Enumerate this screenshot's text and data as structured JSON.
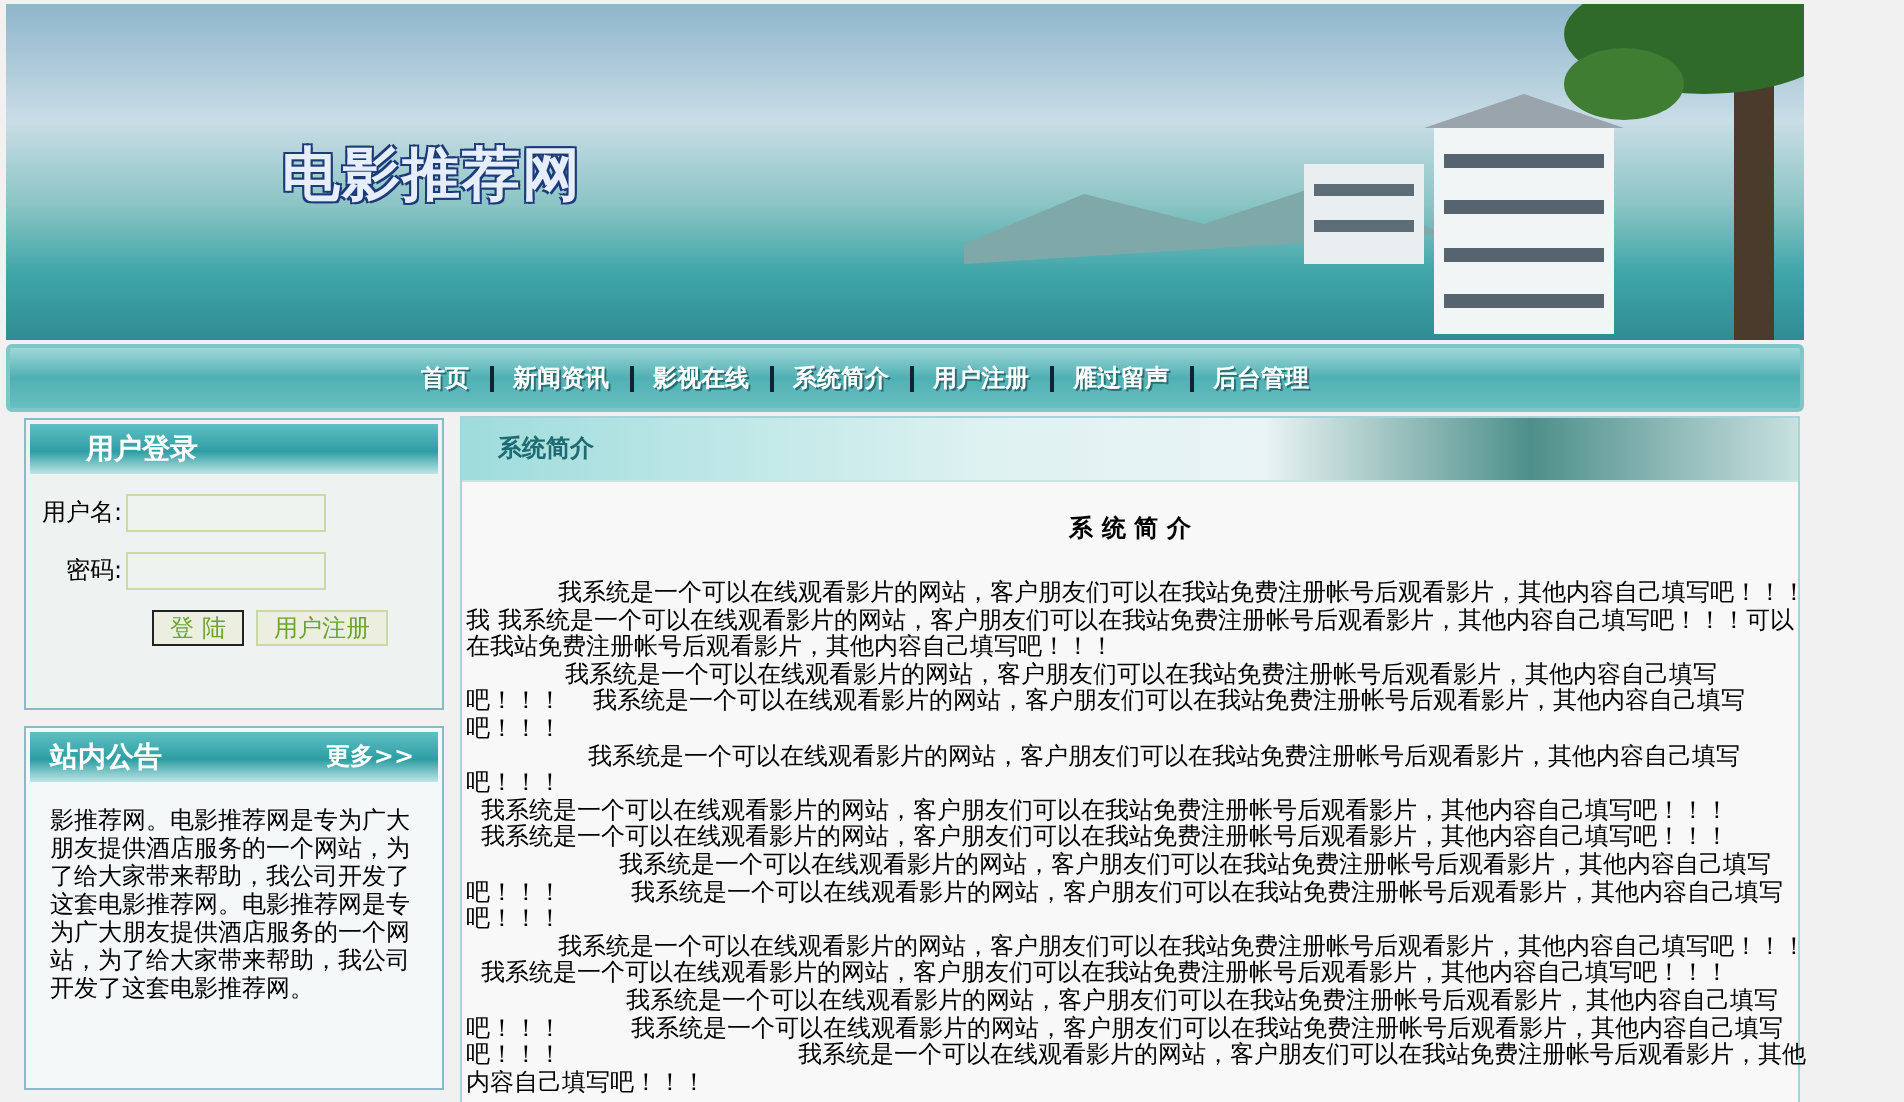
{
  "site_title": "电影推荐网",
  "nav": [
    "首页",
    "新闻资讯",
    "影视在线",
    "系统简介",
    "用户注册",
    "雁过留声",
    "后台管理"
  ],
  "login": {
    "title": "用户登录",
    "fields": [
      {
        "label": "用户名:"
      },
      {
        "label": "密码:"
      }
    ],
    "buttons": [
      {
        "label": "登 陆",
        "kind": "primary"
      },
      {
        "label": "用户注册",
        "kind": "secondary"
      }
    ]
  },
  "notice": {
    "title": "站内公告",
    "more": "更多>>",
    "text": "影推荐网。电影推荐网是专为广大朋友提供酒店服务的一个网站，为了给大家带来帮助，我公司开发了这套电影推荐网。电影推荐网是专为广大朋友提供酒店服务的一个网站，为了给大家带来帮助，我公司开发了这套电影推荐网。"
  },
  "main": {
    "tab": "系统简介",
    "heading": "系 统 简 介",
    "lines": [
      "            我系统是一个可以在线观看影片的网站，客户朋友们可以在我站免费注册帐号后观看影片，其他内容自己填写吧！！！",
      "我 我系统是一个可以在线观看影片的网站，客户朋友们可以在我站免费注册帐号后观看影片，其他内容自己填写吧！！！可以",
      "在我站免费注册帐号后观看影片，其他内容自己填写吧！！！",
      "             我系统是一个可以在线观看影片的网站，客户朋友们可以在我站免费注册帐号后观看影片，其他内容自己填写",
      "吧！！！    我系统是一个可以在线观看影片的网站，客户朋友们可以在我站免费注册帐号后观看影片，其他内容自己填写",
      "吧！！！",
      "                我系统是一个可以在线观看影片的网站，客户朋友们可以在我站免费注册帐号后观看影片，其他内容自己填写",
      "吧！！！",
      "  我系统是一个可以在线观看影片的网站，客户朋友们可以在我站免费注册帐号后观看影片，其他内容自己填写吧！！！",
      "  我系统是一个可以在线观看影片的网站，客户朋友们可以在我站免费注册帐号后观看影片，其他内容自己填写吧！！！",
      "                    我系统是一个可以在线观看影片的网站，客户朋友们可以在我站免费注册帐号后观看影片，其他内容自己填写",
      "吧！！！         我系统是一个可以在线观看影片的网站，客户朋友们可以在我站免费注册帐号后观看影片，其他内容自己填写",
      "吧！！！",
      "            我系统是一个可以在线观看影片的网站，客户朋友们可以在我站免费注册帐号后观看影片，其他内容自己填写吧！！！",
      "  我系统是一个可以在线观看影片的网站，客户朋友们可以在我站免费注册帐号后观看影片，其他内容自己填写吧！！！",
      "                     我系统是一个可以在线观看影片的网站，客户朋友们可以在我站免费注册帐号后观看影片，其他内容自己填写",
      "吧！！！         我系统是一个可以在线观看影片的网站，客户朋友们可以在我站免费注册帐号后观看影片，其他内容自己填写",
      "吧！！！                               我系统是一个可以在线观看影片的网站，客户朋友们可以在我站免费注册帐号后观看影片，其他",
      "内容自己填写吧！！！"
    ]
  }
}
